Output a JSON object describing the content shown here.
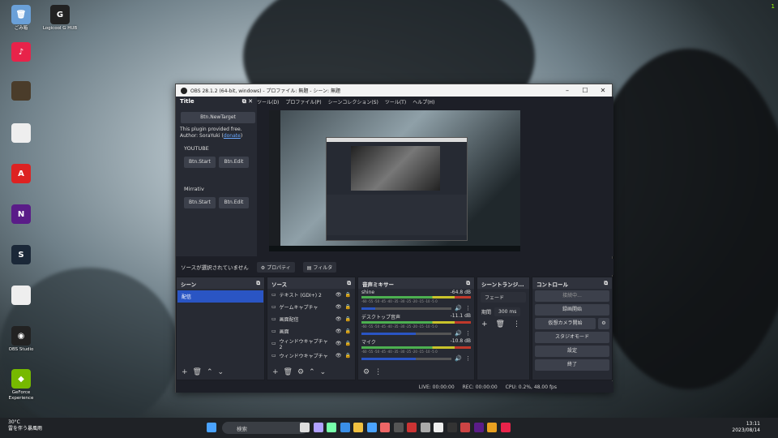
{
  "desktop_icons": [
    {
      "label": "ごみ箱",
      "color": "#6aa0d8",
      "glyph": "🗑"
    },
    {
      "label": "Logicool G HUB",
      "color": "#222",
      "glyph": "G"
    },
    {
      "label": "",
      "color": "#e8234a",
      "glyph": "♪"
    },
    {
      "label": "",
      "color": "#4a3c2a",
      "glyph": ""
    },
    {
      "label": "",
      "color": "#eee",
      "glyph": ""
    },
    {
      "label": "",
      "color": "#d22",
      "glyph": "A"
    },
    {
      "label": "",
      "color": "#5a1c88",
      "glyph": "N"
    },
    {
      "label": "",
      "color": "#1b2838",
      "glyph": "S"
    },
    {
      "label": "",
      "color": "#eee",
      "glyph": ""
    },
    {
      "label": "OBS Studio",
      "color": "#222",
      "glyph": "◉"
    },
    {
      "label": "GeForce Experience",
      "color": "#76b900",
      "glyph": "◆"
    }
  ],
  "window": {
    "title": "OBS 28.1.2 (64-bit, windows) - プロファイル: 無題 - シーン: 無題",
    "controls": [
      "–",
      "☐",
      "✕"
    ]
  },
  "menu": [
    "ツール(D)",
    "プロファイル(P)",
    "シーンコレクション(S)",
    "ツール(T)",
    "ヘルプ(H)"
  ],
  "plugin_dock": {
    "title": "Title",
    "new_target": "Btn.NewTarget",
    "info1": "This plugin provided free.",
    "info2": "Author: SoraYuki (",
    "donate": "donate",
    "info2_end": ")",
    "youtube": "YOUTUBE",
    "mirrativ": "Mirrativ",
    "start": "Btn.Start",
    "edit": "Btn.Edit"
  },
  "source_bar": {
    "message": "ソースが選択されていません",
    "properties": "プロパティ",
    "filters": "フィルタ"
  },
  "scenes": {
    "title": "シーン",
    "items": [
      "配信"
    ]
  },
  "sources": {
    "title": "ソース",
    "items": [
      "テキスト (GDI+) 2",
      "ゲームキャプチャ",
      "画面配信",
      "画面",
      "ウィンドウキャプチャ 2",
      "ウィンドウキャプチャ"
    ]
  },
  "mixer": {
    "title": "音声ミキサー",
    "ticks": "-60 -55 -50 -45 -40 -35 -30 -25 -20 -15 -10 -5 0",
    "channels": [
      {
        "name": "shine",
        "db": "-64.8 dB",
        "vol": 0.15
      },
      {
        "name": "デスクトップ音声",
        "db": "-11.1 dB",
        "vol": 0.6
      },
      {
        "name": "マイク",
        "db": "-10.8 dB",
        "vol": 0.6
      }
    ]
  },
  "transitions": {
    "title": "シーントランジ...",
    "type": "フェード",
    "duration_label": "期間",
    "duration": "300 ms"
  },
  "controls": {
    "title": "コントロール",
    "buttons": [
      "接続中...",
      "録画開始",
      "仮想カメラ開始",
      "スタジオモード",
      "設定",
      "終了"
    ]
  },
  "status": {
    "live": "LIVE: 00:00:00",
    "rec": "REC: 00:00:00",
    "cpu": "CPU: 0.2%, 48.00 fps"
  },
  "taskbar": {
    "temp": "30°C",
    "weather": "雷を伴う暴風雨",
    "search": "検索",
    "time": "13:11",
    "date": "2023/08/14"
  },
  "colors": {
    "accent": "#2a55c4",
    "meter_green": "#4caf50",
    "meter_yellow": "#c9c32b",
    "meter_red": "#c0392b"
  }
}
